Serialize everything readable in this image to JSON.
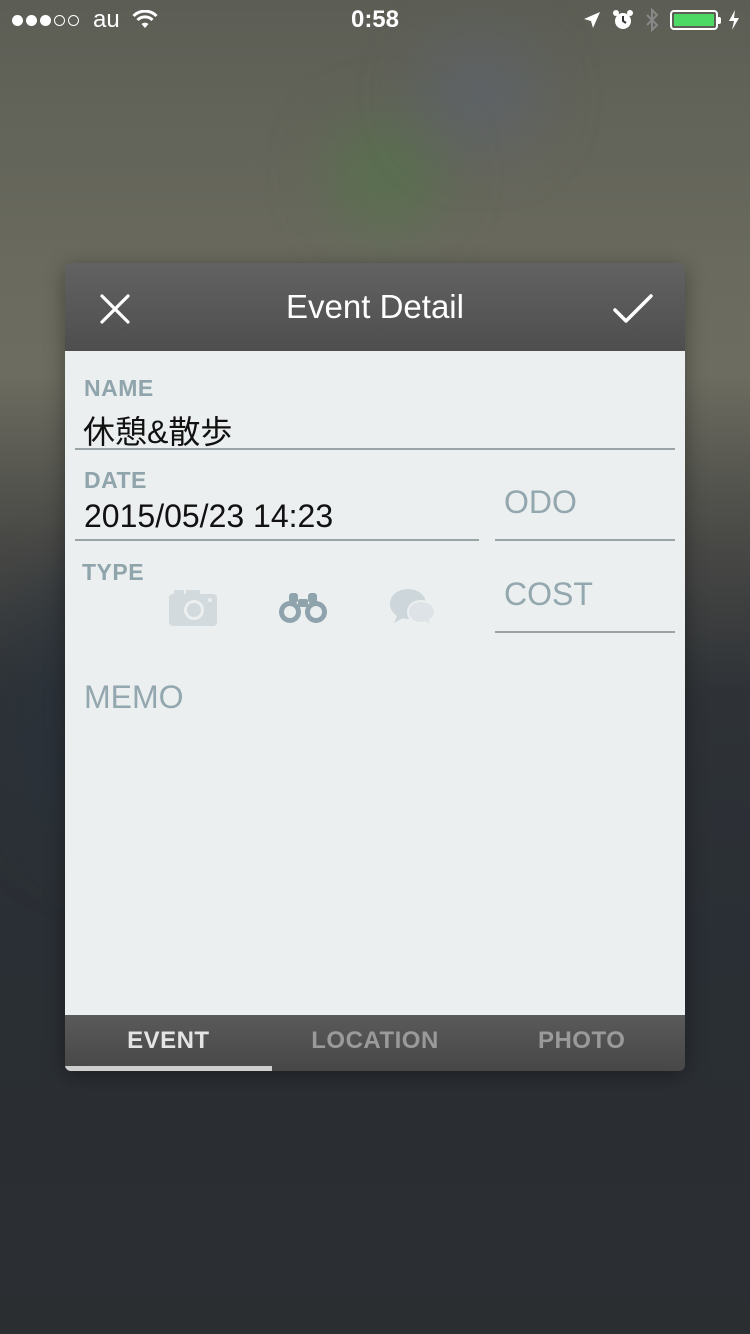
{
  "status_bar": {
    "carrier": "au",
    "time": "0:58"
  },
  "dialog": {
    "title": "Event Detail",
    "close_icon": "close-icon",
    "done_icon": "checkmark-icon"
  },
  "form": {
    "name": {
      "label": "NAME",
      "value": "休憩&散歩"
    },
    "date": {
      "label": "DATE",
      "value": "2015/05/23 14:23"
    },
    "odo": {
      "placeholder": "ODO"
    },
    "cost": {
      "placeholder": "COST"
    },
    "type": {
      "label": "TYPE",
      "icons": [
        "camera-icon",
        "binoculars-icon",
        "chat-bubbles-icon"
      ]
    },
    "memo": {
      "placeholder": "MEMO"
    }
  },
  "tabs": [
    {
      "label": "EVENT",
      "active": true
    },
    {
      "label": "LOCATION",
      "active": false
    },
    {
      "label": "PHOTO",
      "active": false
    }
  ],
  "colors": {
    "battery": "#4cd964",
    "label": "#90a4ab",
    "body_bg": "#ebeff0"
  }
}
